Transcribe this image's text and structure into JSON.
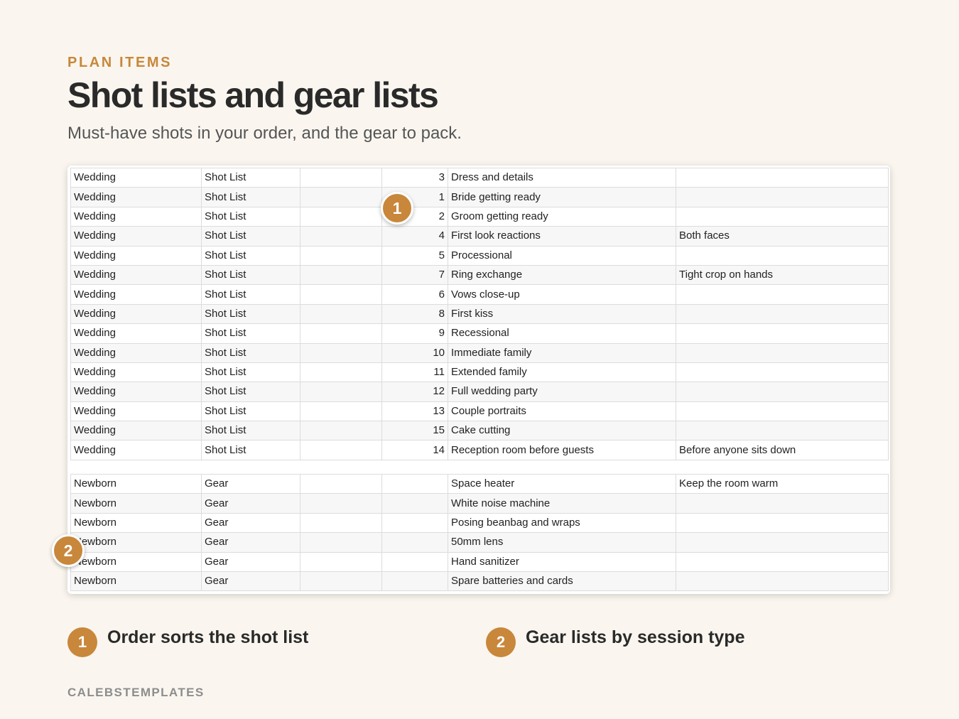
{
  "header": {
    "eyebrow": "PLAN ITEMS",
    "title": "Shot lists and gear lists",
    "subtitle": "Must-have shots in your order, and the gear to pack."
  },
  "shot_list": [
    {
      "session": "Wedding",
      "type": "Shot List",
      "c3": "",
      "order": "3",
      "item": "Dress and details",
      "note": ""
    },
    {
      "session": "Wedding",
      "type": "Shot List",
      "c3": "",
      "order": "1",
      "item": "Bride getting ready",
      "note": ""
    },
    {
      "session": "Wedding",
      "type": "Shot List",
      "c3": "",
      "order": "2",
      "item": "Groom getting ready",
      "note": ""
    },
    {
      "session": "Wedding",
      "type": "Shot List",
      "c3": "",
      "order": "4",
      "item": "First look reactions",
      "note": "Both faces"
    },
    {
      "session": "Wedding",
      "type": "Shot List",
      "c3": "",
      "order": "5",
      "item": "Processional",
      "note": ""
    },
    {
      "session": "Wedding",
      "type": "Shot List",
      "c3": "",
      "order": "7",
      "item": "Ring exchange",
      "note": "Tight crop on hands"
    },
    {
      "session": "Wedding",
      "type": "Shot List",
      "c3": "",
      "order": "6",
      "item": "Vows close-up",
      "note": ""
    },
    {
      "session": "Wedding",
      "type": "Shot List",
      "c3": "",
      "order": "8",
      "item": "First kiss",
      "note": ""
    },
    {
      "session": "Wedding",
      "type": "Shot List",
      "c3": "",
      "order": "9",
      "item": "Recessional",
      "note": ""
    },
    {
      "session": "Wedding",
      "type": "Shot List",
      "c3": "",
      "order": "10",
      "item": "Immediate family",
      "note": ""
    },
    {
      "session": "Wedding",
      "type": "Shot List",
      "c3": "",
      "order": "11",
      "item": "Extended family",
      "note": ""
    },
    {
      "session": "Wedding",
      "type": "Shot List",
      "c3": "",
      "order": "12",
      "item": "Full wedding party",
      "note": ""
    },
    {
      "session": "Wedding",
      "type": "Shot List",
      "c3": "",
      "order": "13",
      "item": "Couple portraits",
      "note": ""
    },
    {
      "session": "Wedding",
      "type": "Shot List",
      "c3": "",
      "order": "15",
      "item": "Cake cutting",
      "note": ""
    },
    {
      "session": "Wedding",
      "type": "Shot List",
      "c3": "",
      "order": "14",
      "item": "Reception room before guests",
      "note": "Before anyone sits down"
    }
  ],
  "gear_list": [
    {
      "session": "Newborn",
      "type": "Gear",
      "c3": "",
      "order": "",
      "item": "Space heater",
      "note": "Keep the room warm"
    },
    {
      "session": "Newborn",
      "type": "Gear",
      "c3": "",
      "order": "",
      "item": "White noise machine",
      "note": ""
    },
    {
      "session": "Newborn",
      "type": "Gear",
      "c3": "",
      "order": "",
      "item": "Posing beanbag and wraps",
      "note": ""
    },
    {
      "session": "Newborn",
      "type": "Gear",
      "c3": "",
      "order": "",
      "item": "50mm lens",
      "note": ""
    },
    {
      "session": "Newborn",
      "type": "Gear",
      "c3": "",
      "order": "",
      "item": "Hand sanitizer",
      "note": ""
    },
    {
      "session": "Newborn",
      "type": "Gear",
      "c3": "",
      "order": "",
      "item": "Spare batteries and cards",
      "note": ""
    }
  ],
  "markers": {
    "one": "1",
    "two": "2"
  },
  "legend": [
    {
      "num": "1",
      "label": "Order sorts the shot list"
    },
    {
      "num": "2",
      "label": "Gear lists by session type"
    }
  ],
  "brand": "CALEBSTEMPLATES",
  "colors": {
    "accent": "#c8873a",
    "background": "#faf6ef",
    "grid_line": "#dcdcdc",
    "row_stripe": "#f7f7f7"
  }
}
